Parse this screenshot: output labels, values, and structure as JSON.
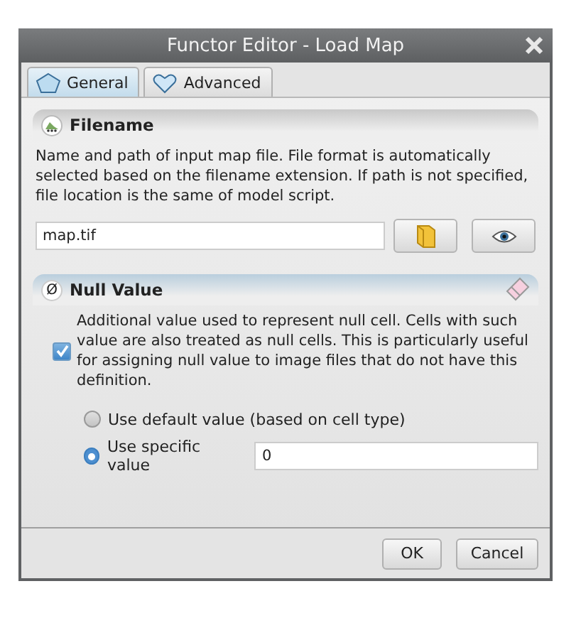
{
  "window": {
    "title": "Functor Editor - Load Map"
  },
  "tabs": [
    {
      "label": "General",
      "selected": true,
      "kind": "pentagon"
    },
    {
      "label": "Advanced",
      "selected": false,
      "kind": "heart"
    }
  ],
  "filename": {
    "title": "Filename",
    "description": "Name and path of input map file. File format is automatically selected based on the filename extension. If path is not specified, file location is the same of model script.",
    "value": "map.tif"
  },
  "null_value": {
    "icon": "Ø",
    "title": "Null Value",
    "checked": true,
    "description": "Additional value used to represent null cell. Cells with such value are also treated as null cells. This is particularly useful for assigning null value to image files that do not have this definition.",
    "options": [
      {
        "label": "Use default value (based on cell type)",
        "selected": false
      },
      {
        "label": "Use specific value",
        "selected": true
      }
    ],
    "value": "0"
  },
  "buttons": [
    "OK",
    "Cancel"
  ]
}
